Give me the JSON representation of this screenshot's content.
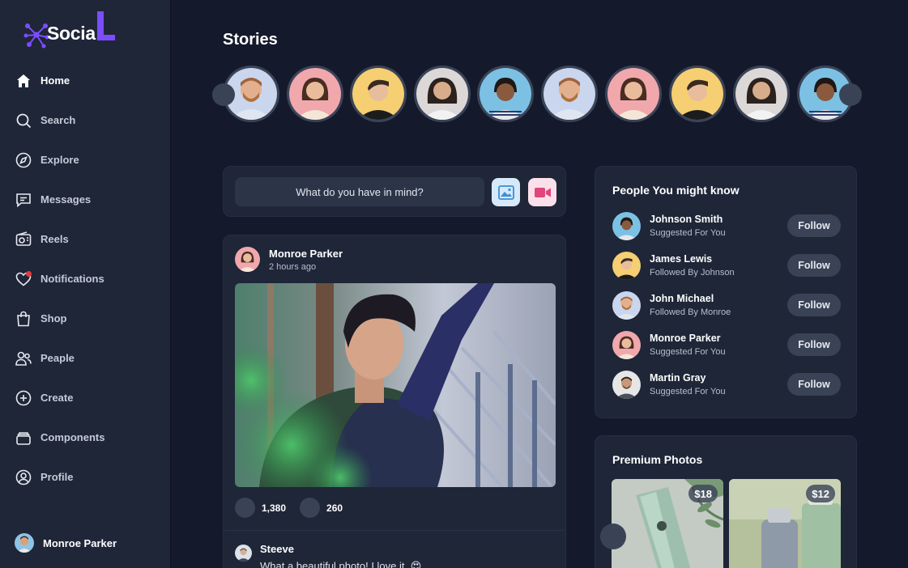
{
  "app": {
    "logo_text": "Socia",
    "logo_letter": "L"
  },
  "sidebar": {
    "items": [
      {
        "label": "Home",
        "icon": "home-icon",
        "active": true
      },
      {
        "label": "Search",
        "icon": "search-icon"
      },
      {
        "label": "Explore",
        "icon": "compass-icon"
      },
      {
        "label": "Messages",
        "icon": "message-icon"
      },
      {
        "label": "Reels",
        "icon": "reels-icon"
      },
      {
        "label": "Notifications",
        "icon": "heart-icon"
      },
      {
        "label": "Shop",
        "icon": "shopping-bag-icon"
      },
      {
        "label": "Peaple",
        "icon": "people-icon"
      },
      {
        "label": "Create",
        "icon": "plus-circle-icon"
      },
      {
        "label": "Components",
        "icon": "layers-icon"
      },
      {
        "label": "Profile",
        "icon": "user-circle-icon"
      }
    ],
    "user_name": "Monroe Parker"
  },
  "stories": {
    "title": "Stories"
  },
  "composer": {
    "placeholder": "What do you have in mind?",
    "photo_icon": "image-icon",
    "video_icon": "video-icon"
  },
  "post": {
    "author": "Monroe Parker",
    "time": "2 hours ago",
    "likes": "1,380",
    "comments": "260",
    "comment": {
      "name": "Steeve",
      "text": "What a beautiful photo! I love it. 😍"
    }
  },
  "people": {
    "title": "People You might know",
    "follow_label": "Follow",
    "items": [
      {
        "name": "Johnson Smith",
        "sub": "Suggested For You"
      },
      {
        "name": "James Lewis",
        "sub": "Followed By Johnson"
      },
      {
        "name": "John Michael",
        "sub": "Followed By Monroe"
      },
      {
        "name": "Monroe Parker",
        "sub": "Suggested For You"
      },
      {
        "name": "Martin Gray",
        "sub": "Suggested For You"
      }
    ]
  },
  "premium": {
    "title": "Premium Photos",
    "items": [
      {
        "price": "$18"
      },
      {
        "price": "$12"
      }
    ]
  },
  "colors": {
    "background": "#141a2b",
    "panel": "#1e2638",
    "accent": "#7b4dff",
    "notification": "#e23b3b"
  }
}
